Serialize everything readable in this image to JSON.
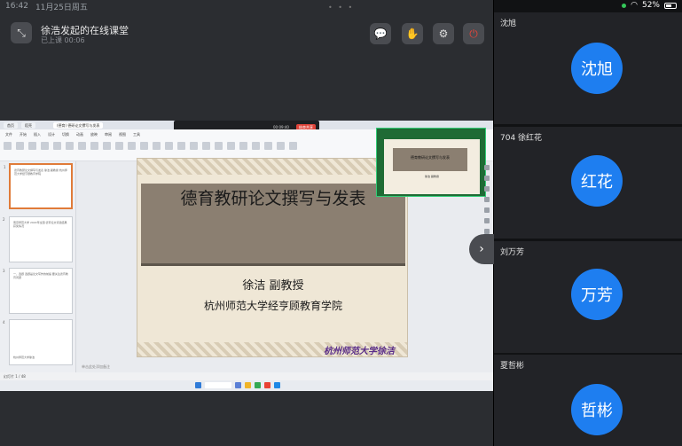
{
  "status_bar": {
    "time": "16:42",
    "date": "11月25日周五",
    "battery": "52%",
    "dots": "• • •"
  },
  "meeting": {
    "title": "徐浩发起的在线课堂",
    "subtitle": "已上课 00:06"
  },
  "shared_window": {
    "tabs": [
      "首页",
      "稻壳",
      "(德育) 德研论文撰写与发表"
    ],
    "ribbon_menu": [
      "文件",
      "开始",
      "插入",
      "设计",
      "切换",
      "动画",
      "放映",
      "审阅",
      "视图",
      "工具"
    ],
    "meeting_bar_timer": "00:09:40",
    "meeting_bar_end": "结束共享",
    "thumbnails": [
      {
        "num": "1",
        "text": "德育教研论文撰写与发表 徐洁 副教授 杭州师范大学经亨颐教育学院"
      },
      {
        "num": "2",
        "text": "南京师范大学 2022年全国 德育论文评选结果 获奖情况"
      },
      {
        "num": "3",
        "text": "一、选题 选题是论文写作的前提 要关注德育教育问题"
      },
      {
        "num": "4",
        "text": "杭州师范大学徐洁"
      }
    ],
    "slide": {
      "title": "德育教研论文撰写与发表",
      "author": "徐洁 副教授",
      "institution": "杭州师范大学经亨顾教育学院",
      "watermark": "杭州师范大学徐洁"
    },
    "pip": {
      "title": "德育教研论文撰写与发表",
      "author": "徐洁 副教授"
    },
    "notes_placeholder": "单击此处添加备注",
    "status_text": "幻灯片 1 / 48"
  },
  "participants": [
    {
      "name": "沈旭",
      "avatar": "沈旭"
    },
    {
      "name": "704 徐红花",
      "avatar": "红花"
    },
    {
      "name": "刘万芳",
      "avatar": "万芳"
    },
    {
      "name": "夏哲彬",
      "avatar": "哲彬"
    }
  ]
}
